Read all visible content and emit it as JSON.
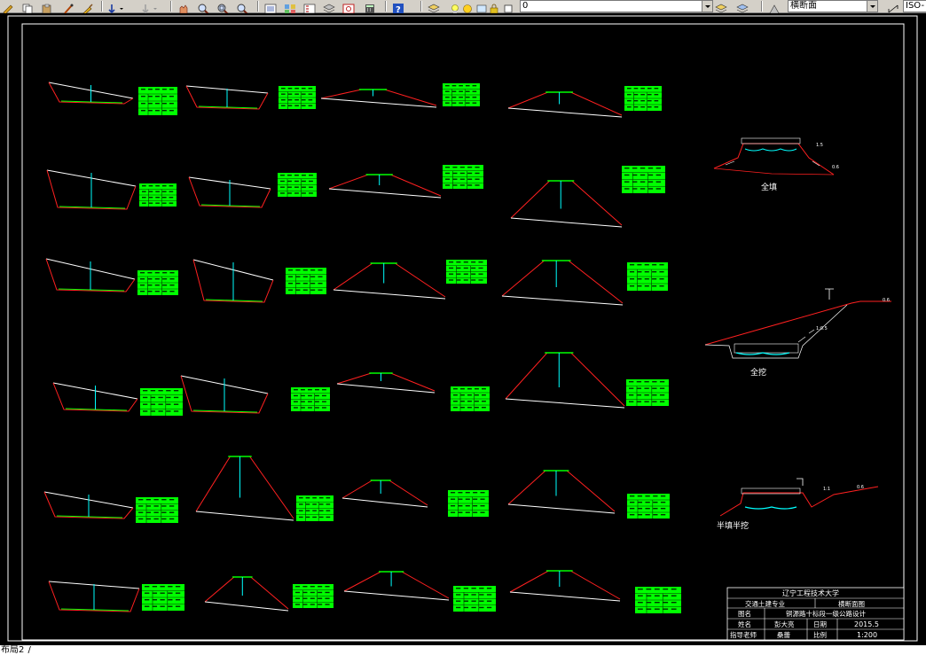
{
  "toolbar": {
    "layer_value": "0",
    "view_value": "横断面",
    "scale_value": "ISO-"
  },
  "drawing": {
    "labels": {
      "full_fill": "全填",
      "full_cut": "全挖",
      "half_fill_half_cut": "半填半挖"
    },
    "title_block": {
      "university": "辽宁工程技术大学",
      "major": "交通土建专业",
      "drawing_title": "横断面图",
      "drawing_name_label": "图名",
      "drawing_name": "铜源路十标段一级公路设计",
      "name_label": "姓名",
      "name_value": "彭大亮",
      "date_label": "日期",
      "date_value": "2015.5",
      "advisor_label": "指导老师",
      "advisor_value": "桑蕾",
      "scale_label": "比例",
      "scale_value": "1:200"
    }
  },
  "status": {
    "layout_tab": "布局2"
  },
  "colors": {
    "ground": "#ffffff",
    "slope": "#ff2020",
    "centerline": "#00ffff",
    "road_surface": "#00ff00",
    "table_fill": "#00ff00",
    "toolbar": "#d4d0c8"
  }
}
